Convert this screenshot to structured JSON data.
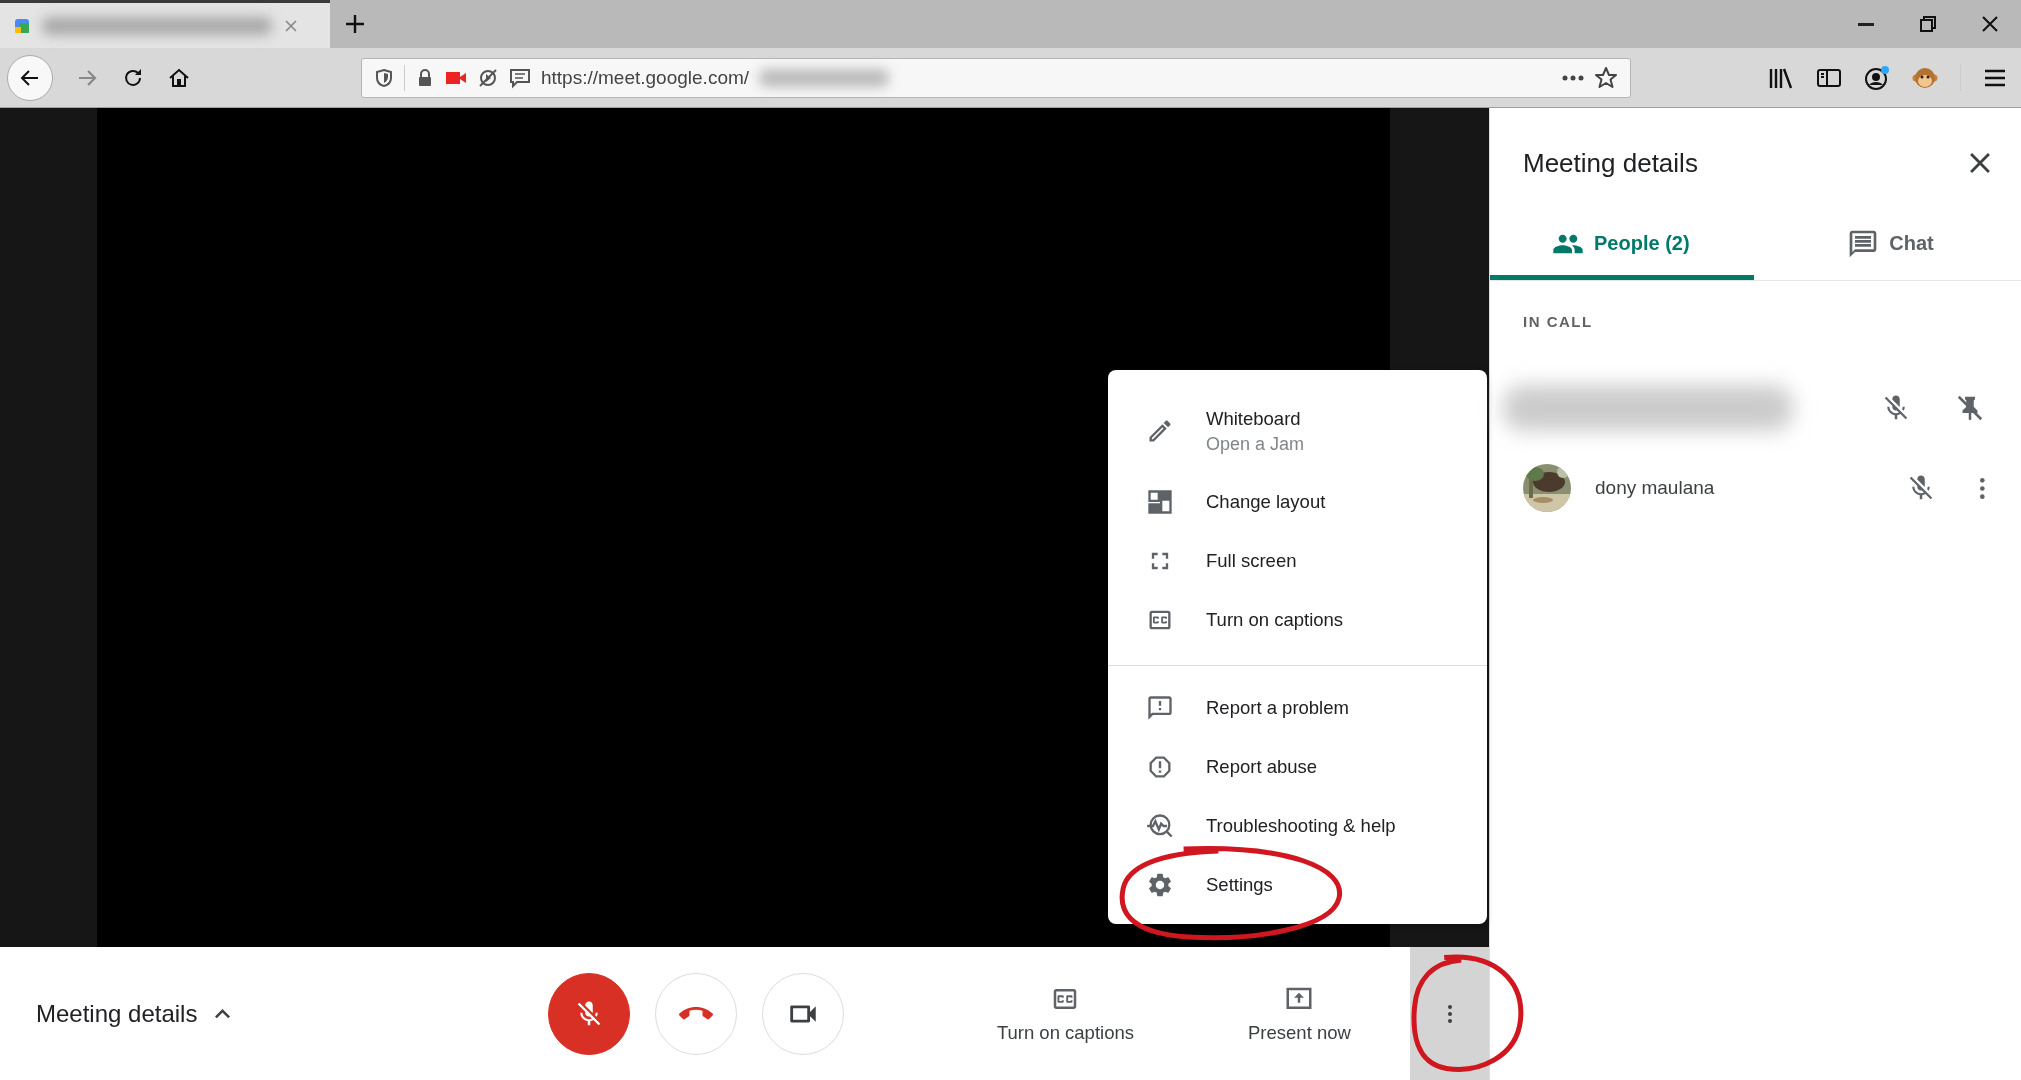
{
  "browser": {
    "address_bar": {
      "url": "https://meet.google.com/"
    }
  },
  "menu": {
    "groups": [
      [
        {
          "label": "Whiteboard",
          "sublabel": "Open a Jam",
          "circled": false
        },
        {
          "label": "Change layout",
          "circled": false
        },
        {
          "label": "Full screen",
          "circled": false
        },
        {
          "label": "Turn on captions",
          "circled": false
        }
      ],
      [
        {
          "label": "Report a problem",
          "circled": false
        },
        {
          "label": "Report abuse",
          "circled": false
        },
        {
          "label": "Troubleshooting & help",
          "circled": false
        },
        {
          "label": "Settings",
          "circled": true
        }
      ]
    ]
  },
  "bottom_bar": {
    "meeting_details": "Meeting details",
    "mic": {
      "muted": true
    },
    "actions": [
      {
        "label": "Turn on captions"
      },
      {
        "label": "Present now"
      }
    ],
    "more": {
      "active": true,
      "circled": true
    }
  },
  "panel": {
    "title": "Meeting details",
    "tabs": [
      {
        "label": "People (2)",
        "selected": true
      },
      {
        "label": "Chat",
        "selected": false
      }
    ],
    "section": "IN CALL",
    "participants": [
      {
        "kind": "redacted"
      },
      {
        "kind": "person",
        "name": "dony maulana"
      }
    ]
  }
}
